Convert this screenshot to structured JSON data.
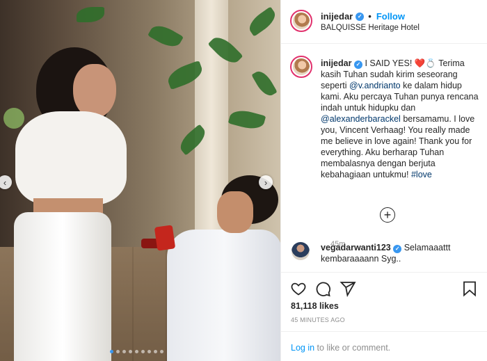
{
  "post": {
    "username": "inijedar",
    "follow_label": "Follow",
    "location": "BALQUISSE Heritage Hotel",
    "caption": {
      "username": "inijedar",
      "lead": "I SAID YES!",
      "heart": "❤️",
      "ring": "💍",
      "part1": "Terima kasih Tuhan sudah kirim seseorang seperti",
      "mention1": "@v.andrianto",
      "part2": "ke dalam hidup kami. Aku percaya Tuhan punya rencana indah untuk hidupku dan",
      "mention2": "@alexanderbarackel",
      "part3": "bersamamu. I love you, Vincent Verhaag! You really made me believe in love again! Thank you for everything. Aku berharap Tuhan membalasnya dengan berjuta kebahagiaan untukmu!",
      "hashtag": "#love",
      "time": "45m"
    },
    "comments": [
      {
        "username": "vegadarwanti123",
        "text": "Selamaaattt kembaraaaann Syg.."
      }
    ],
    "likes": "81,118 likes",
    "posted_ago": "45 MINUTES AGO",
    "login_link": "Log in",
    "login_rest": "to like or comment.",
    "nav": {
      "prev": "‹",
      "next": "›"
    },
    "load_more": "+",
    "verified_mark": "✓"
  },
  "carousel": {
    "count": 9,
    "active_index": 0
  },
  "colors": {
    "link": "#0095f6",
    "mention": "#00376b",
    "muted": "#8e8e8e"
  },
  "icons": [
    "heart-icon",
    "comment-icon",
    "share-icon",
    "bookmark-icon",
    "plus-circle-icon",
    "verified-icon"
  ]
}
